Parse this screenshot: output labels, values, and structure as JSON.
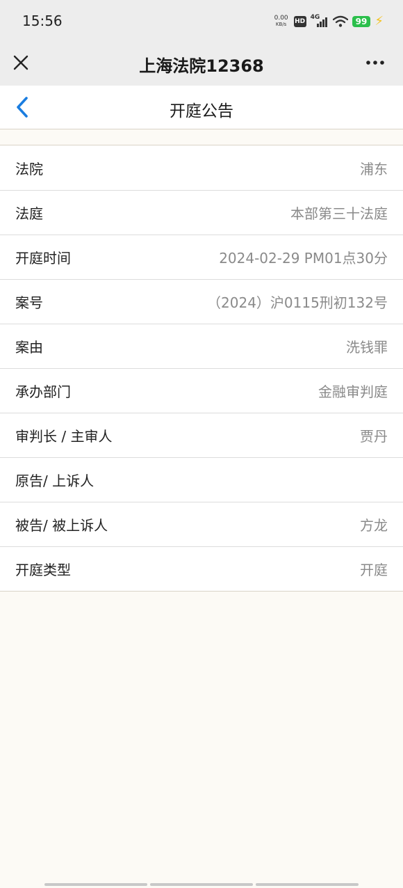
{
  "status_bar": {
    "time": "15:56",
    "net_speed_value": "0.00",
    "net_speed_unit": "KB/s",
    "hd_label": "HD",
    "network_type": "4G",
    "battery_level": "99",
    "icons": [
      "hd-icon",
      "signal-icon",
      "wifi-icon",
      "battery-icon",
      "charging-bolt-icon"
    ]
  },
  "web_titlebar": {
    "title": "上海法院12368",
    "close_icon": "close-icon",
    "more_icon": "more-icon"
  },
  "page_header": {
    "title": "开庭公告",
    "back_icon": "chevron-left-icon"
  },
  "details": [
    {
      "label": "法院",
      "value": "浦东"
    },
    {
      "label": "法庭",
      "value": "本部第三十法庭"
    },
    {
      "label": "开庭时间",
      "value": "2024-02-29 PM01点30分"
    },
    {
      "label": "案号",
      "value": "（2024）沪0115刑初132号"
    },
    {
      "label": "案由",
      "value": "洗钱罪"
    },
    {
      "label": "承办部门",
      "value": "金融审判庭"
    },
    {
      "label": "审判长 / 主审人",
      "value": "贾丹"
    },
    {
      "label": "原告/ 上诉人",
      "value": ""
    },
    {
      "label": "被告/ 被上诉人",
      "value": "方龙"
    },
    {
      "label": "开庭类型",
      "value": "开庭"
    }
  ],
  "colors": {
    "accent": "#1a7de0",
    "battery": "#2bbf4b",
    "bar_bg": "#ededed",
    "page_bg": "#fcfaf5"
  }
}
